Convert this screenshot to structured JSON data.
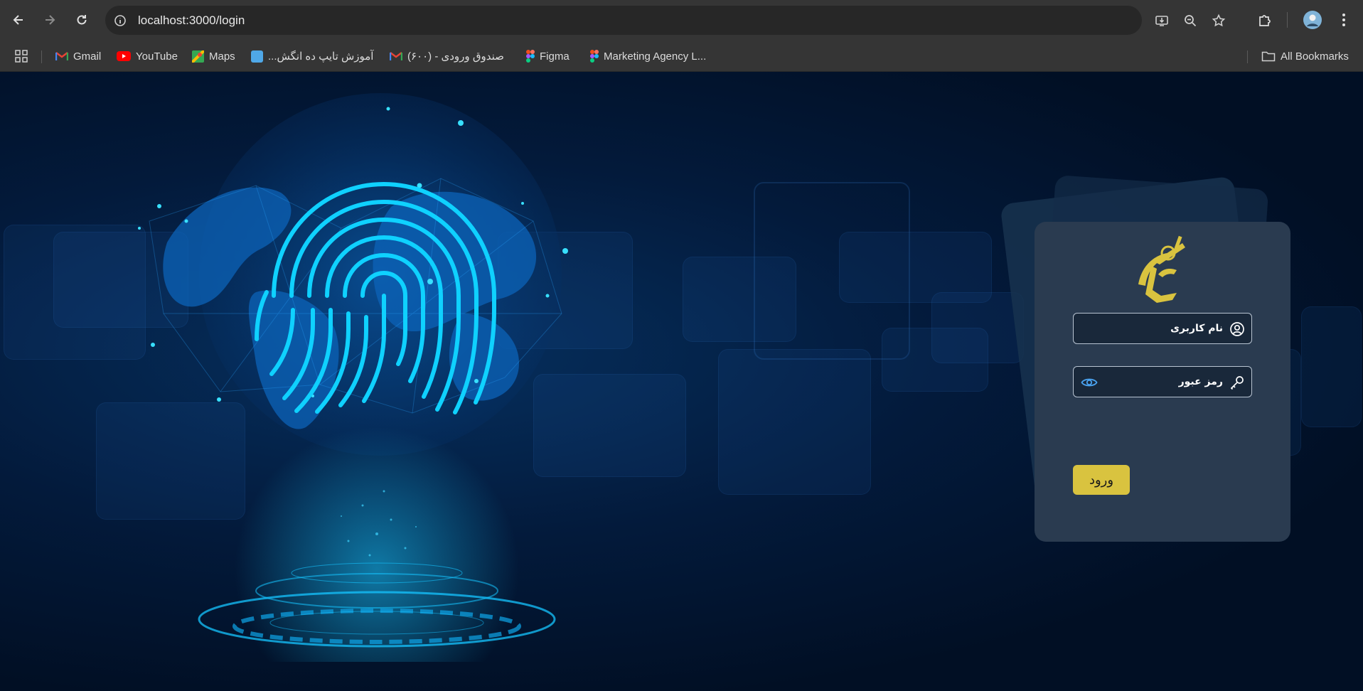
{
  "browser": {
    "url": "localhost:3000/login",
    "bookmarks": [
      {
        "label": "Gmail",
        "icon": "gmail-icon"
      },
      {
        "label": "YouTube",
        "icon": "youtube-icon"
      },
      {
        "label": "Maps",
        "icon": "maps-icon"
      },
      {
        "label": "آموزش تایپ ده انگش...",
        "icon": "typing-site-icon"
      },
      {
        "label": "صندوق ورودی - (۶۰۰)",
        "icon": "gmail-icon"
      },
      {
        "label": "Figma",
        "icon": "figma-icon"
      },
      {
        "label": "Marketing Agency L...",
        "icon": "figma-icon"
      }
    ],
    "all_bookmarks_label": "All Bookmarks"
  },
  "login": {
    "username_placeholder": "نام کاربری",
    "password_placeholder": "رمز عبور",
    "submit_label": "ورود",
    "accent_color": "#d9c33f"
  },
  "hero": {
    "accent_color": "#00c8ff"
  }
}
